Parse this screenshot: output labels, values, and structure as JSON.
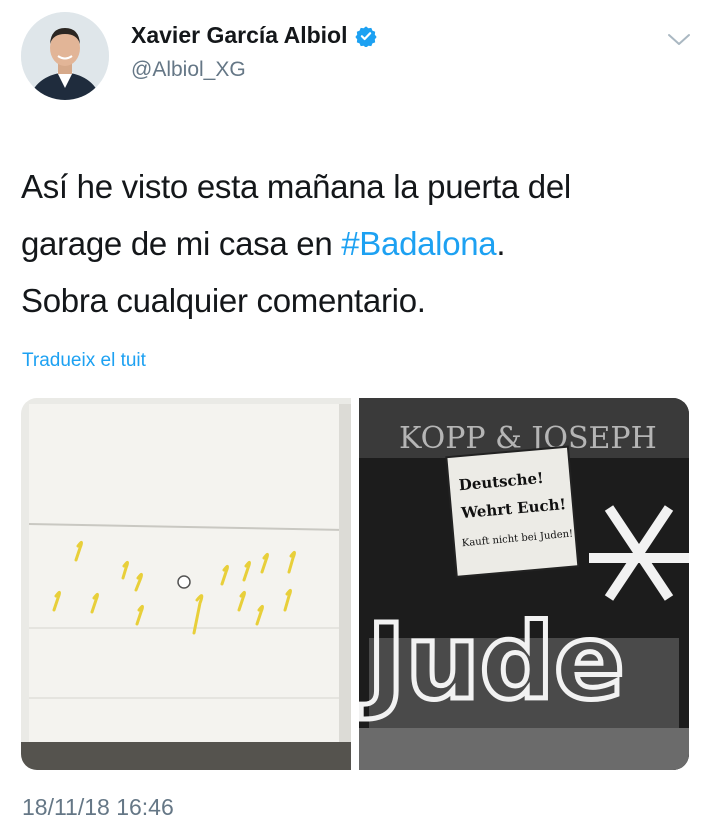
{
  "author": {
    "name": "Xavier García Albiol",
    "handle": "@Albiol_XG",
    "verified": true
  },
  "tweet": {
    "lines": [
      "Así he visto esta mañana la puerta del",
      "garage de mi casa en ",
      "Sobra cualquier comentario."
    ],
    "hashtag": "#Badalona",
    "after_hashtag": "."
  },
  "translate_label": "Tradueix el tuit",
  "media": {
    "left_image": "garage-door-with-yellow-ribbons",
    "right_image": "historical-shop-window-judenboykott",
    "sign_lines": [
      "Deutsche!",
      "Wehrt Euch!",
      "Kauft nicht bei Juden!"
    ],
    "shop_name": "KOPP & JOSEPH",
    "window_text": "Jude"
  },
  "timestamp": "18/11/18 16:46",
  "colors": {
    "link": "#1da1f2",
    "secondary": "#657786",
    "text": "#14171a",
    "ribbon": "#e8cf3a"
  },
  "icons": {
    "verified": "verified-badge-icon",
    "menu": "chevron-down-icon"
  }
}
